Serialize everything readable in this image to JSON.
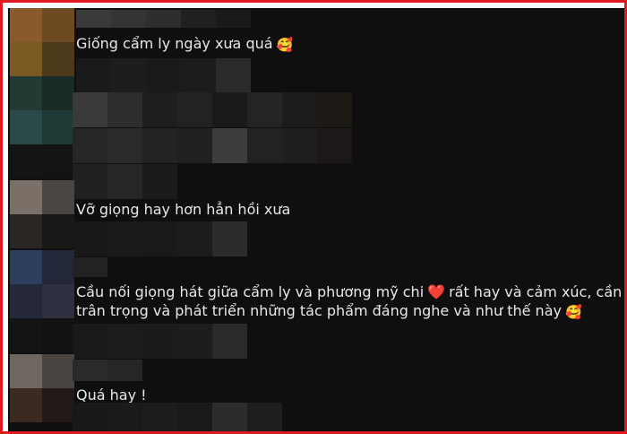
{
  "comments": [
    {
      "text": "Giống cẩm ly ngày xưa quá",
      "emoji": "🥰"
    },
    {
      "text": "Vỡ giọng hay hơn hẳn hồi xưa"
    },
    {
      "line1_before": "Cầu nối giọng hát giữa cẩm ly và phương mỹ chi",
      "heart": "❤️",
      "line1_after": "rất hay và cảm xúc, cần",
      "line2": "trân trọng và phát triển những tác phẩm đáng nghe và như thế này",
      "emoji": "🥰"
    },
    {
      "text": "Quá hay !"
    }
  ],
  "icons": [
    "smiling-face-with-hearts-icon",
    "red-heart-icon",
    "pixelated-avatar-icon"
  ],
  "colors": {
    "frame_border": "#e01a22",
    "background": "#0f0f10",
    "text": "#e8e8e8"
  }
}
